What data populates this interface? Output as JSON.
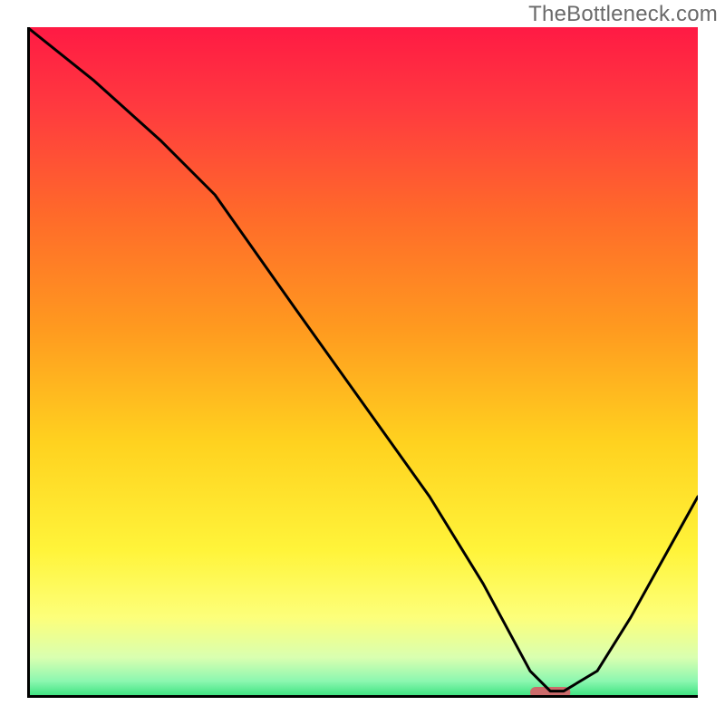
{
  "watermark": "TheBottleneck.com",
  "chart_data": {
    "type": "line",
    "title": "",
    "xlabel": "",
    "ylabel": "",
    "xlim": [
      0,
      100
    ],
    "ylim": [
      0,
      100
    ],
    "grid": false,
    "series": [
      {
        "name": "bottleneck-curve",
        "x": [
          0,
          10,
          20,
          28,
          40,
          50,
          60,
          68,
          75,
          78,
          80,
          85,
          90,
          95,
          100
        ],
        "y": [
          100,
          92,
          83,
          75,
          58,
          44,
          30,
          17,
          4,
          1,
          1,
          4,
          12,
          21,
          30
        ]
      }
    ],
    "marker": {
      "name": "optimum-marker",
      "x_center": 78,
      "width": 6,
      "color": "#cc6b6b"
    },
    "gradient_stops": [
      {
        "offset": 0.0,
        "color": "#ff1a44"
      },
      {
        "offset": 0.12,
        "color": "#ff3a3f"
      },
      {
        "offset": 0.28,
        "color": "#ff6a2a"
      },
      {
        "offset": 0.45,
        "color": "#ff9a1f"
      },
      {
        "offset": 0.62,
        "color": "#ffd21f"
      },
      {
        "offset": 0.78,
        "color": "#fff43a"
      },
      {
        "offset": 0.88,
        "color": "#fdff7a"
      },
      {
        "offset": 0.94,
        "color": "#d9ffb0"
      },
      {
        "offset": 0.975,
        "color": "#8cf7b0"
      },
      {
        "offset": 1.0,
        "color": "#33e07a"
      }
    ]
  }
}
